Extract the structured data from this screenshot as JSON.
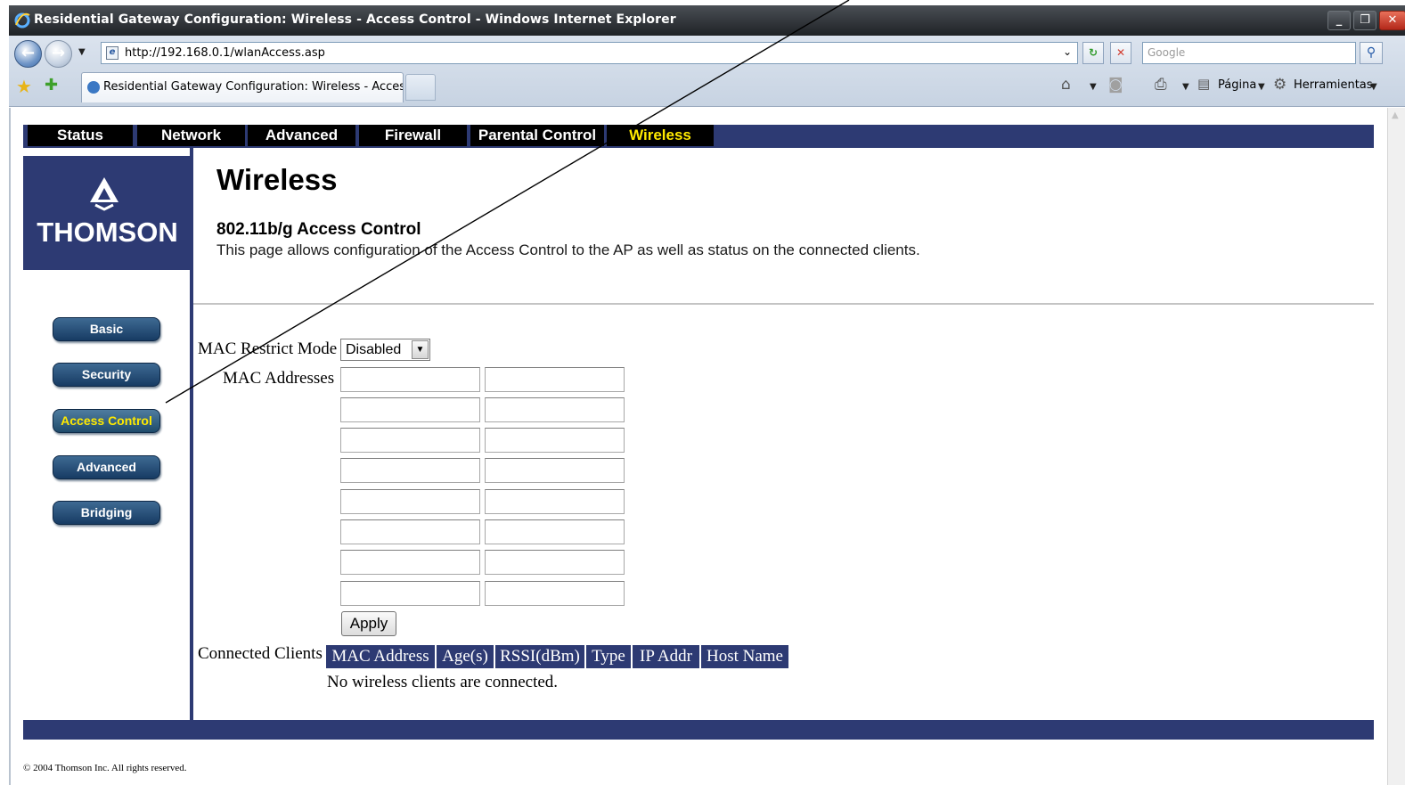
{
  "window": {
    "title": "Residential Gateway Configuration: Wireless - Access Control - Windows Internet Explorer",
    "minimize": "_",
    "maximize": "❐",
    "close": "✕"
  },
  "browser": {
    "address": "http://192.168.0.1/wlanAccess.asp",
    "search_placeholder": "Google",
    "tab_title": "Residential Gateway Configuration: Wireless - Access ...",
    "page_menu": "Página",
    "tools_menu": "Herramientas"
  },
  "router": {
    "nav": [
      "Status",
      "Network",
      "Advanced",
      "Firewall",
      "Parental Control",
      "Wireless"
    ],
    "active_nav": "Wireless",
    "brand": "THOMSON",
    "sidebar": [
      "Basic",
      "Security",
      "Access Control",
      "Advanced",
      "Bridging"
    ],
    "active_sidebar": "Access Control",
    "page_title": "Wireless",
    "section_title": "802.11b/g Access Control",
    "section_desc": "This page allows configuration of the Access Control to the AP as well as status on the connected clients.",
    "restrict_label": "MAC Restrict Mode",
    "restrict_value": "Disabled",
    "mac_label": "MAC Addresses",
    "mac_addresses": [
      "",
      "",
      "",
      "",
      "",
      "",
      "",
      "",
      "",
      "",
      "",
      "",
      "",
      "",
      "",
      ""
    ],
    "apply_label": "Apply",
    "clients_label": "Connected Clients",
    "client_columns": [
      "MAC Address",
      "Age(s)",
      "RSSI(dBm)",
      "Type",
      "IP Addr",
      "Host Name"
    ],
    "no_clients": "No wireless clients are connected.",
    "copyright": "© 2004 Thomson Inc.  All rights reserved."
  },
  "colors": {
    "nav_blue": "#2d3a73",
    "active_text": "#ffea00"
  }
}
